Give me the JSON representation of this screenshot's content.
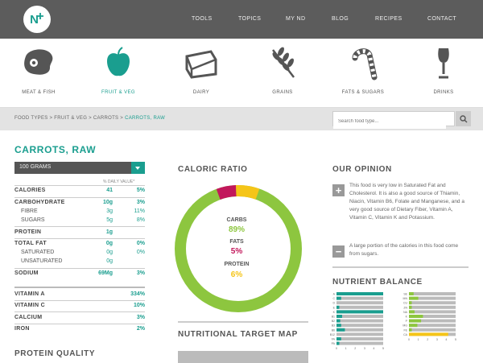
{
  "header": {
    "logo_text": "N",
    "nav": [
      "TOOLS",
      "TOPICS",
      "MY ND",
      "BLOG",
      "RECIPES",
      "CONTACT"
    ]
  },
  "categories": [
    {
      "label": "MEAT & FISH",
      "icon": "steak-icon",
      "active": false
    },
    {
      "label": "FRUIT & VEG",
      "icon": "apple-icon",
      "active": true
    },
    {
      "label": "DAIRY",
      "icon": "cheese-icon",
      "active": false
    },
    {
      "label": "GRAINS",
      "icon": "wheat-icon",
      "active": false
    },
    {
      "label": "FATS & SUGARS",
      "icon": "candy-cane-icon",
      "active": false
    },
    {
      "label": "DRINKS",
      "icon": "wine-glass-icon",
      "active": false
    }
  ],
  "breadcrumb": {
    "path": "FOOD TYPES > FRUIT & VEG > CARROTS > ",
    "current": "CARROTS, RAW"
  },
  "search": {
    "placeholder": "Search food type..."
  },
  "food": {
    "title": "CARROTS, RAW",
    "serving": "100 GRAMS",
    "daily_value_label": "% DAILY VALUE*",
    "nutrients": [
      {
        "name": "CALORIES",
        "value": "41",
        "pct": "5%"
      },
      {
        "name": "CARBOHYDRATE",
        "value": "10g",
        "pct": "3%"
      },
      {
        "name": "FIBRE",
        "value": "3g",
        "pct": "11%"
      },
      {
        "name": "SUGARS",
        "value": "5g",
        "pct": "8%"
      },
      {
        "name": "PROTEIN",
        "value": "1g",
        "pct": ""
      },
      {
        "name": "TOTAL FAT",
        "value": "0g",
        "pct": "0%"
      },
      {
        "name": "SATURATED",
        "value": "0g",
        "pct": "0%"
      },
      {
        "name": "UNSATURATED",
        "value": "0g",
        "pct": ""
      },
      {
        "name": "SODIUM",
        "value": "69Mg",
        "pct": "3%"
      }
    ],
    "vitamins": [
      {
        "name": "VITAMIN A",
        "pct": "334%"
      },
      {
        "name": "VITAMIN C",
        "pct": "10%"
      },
      {
        "name": "CALCIUM",
        "pct": "3%"
      },
      {
        "name": "IRON",
        "pct": "2%"
      }
    ],
    "protein_quality_title": "PROTEIN QUALITY"
  },
  "caloric_ratio": {
    "title": "CALORIC RATIO",
    "carbs_label": "CARBS",
    "carbs_value": "89%",
    "fats_label": "FATS",
    "fats_value": "5%",
    "protein_label": "PROTEIN",
    "protein_value": "6%",
    "carbs_fraction": 0.89,
    "fats_fraction": 0.05,
    "protein_fraction": 0.06,
    "colors": {
      "carbs": "#8dc63f",
      "fats": "#c2185b",
      "protein": "#f5c518"
    }
  },
  "target_map": {
    "title": "NUTRITIONAL TARGET MAP"
  },
  "opinion": {
    "title": "OUR OPINION",
    "positive": "This food is very low in Saturated Fat and Cholesterol. It is also a good source of Thiamin, Niacin, Vitamin B6, Folate and Manganese, and a very good source of Dietary Fiber, Vitamin A, Vitamin C, Vitamin K and Potassium.",
    "negative": "A large portion of the calories in this food come from sugars."
  },
  "nutrient_balance": {
    "title": "NUTRIENT BALANCE",
    "left_labels": [
      "A",
      "C",
      "D",
      "E",
      "K",
      "B1",
      "B2",
      "B3",
      "B6",
      "B12",
      "FA",
      "PA"
    ],
    "right_labels": [
      "SE",
      "MN",
      "CU",
      "ZN",
      "NA",
      "K",
      "P",
      "MG",
      "FE",
      "CA"
    ],
    "axis_ticks": [
      "0",
      "1",
      "2",
      "3",
      "4",
      "5"
    ],
    "left_values": [
      5,
      0.5,
      0,
      0.3,
      5,
      0.6,
      0.4,
      0.5,
      0.9,
      0,
      0.5,
      0.3
    ],
    "right_values": [
      0.5,
      1,
      0.3,
      0.3,
      0.6,
      1.5,
      1.3,
      0.9,
      0.3,
      4.2,
      0.4
    ],
    "colors": {
      "left": "#1a9e8f",
      "right": "#8dc63f",
      "highlight": "#f5c518",
      "track": "#bbbbbb"
    }
  }
}
